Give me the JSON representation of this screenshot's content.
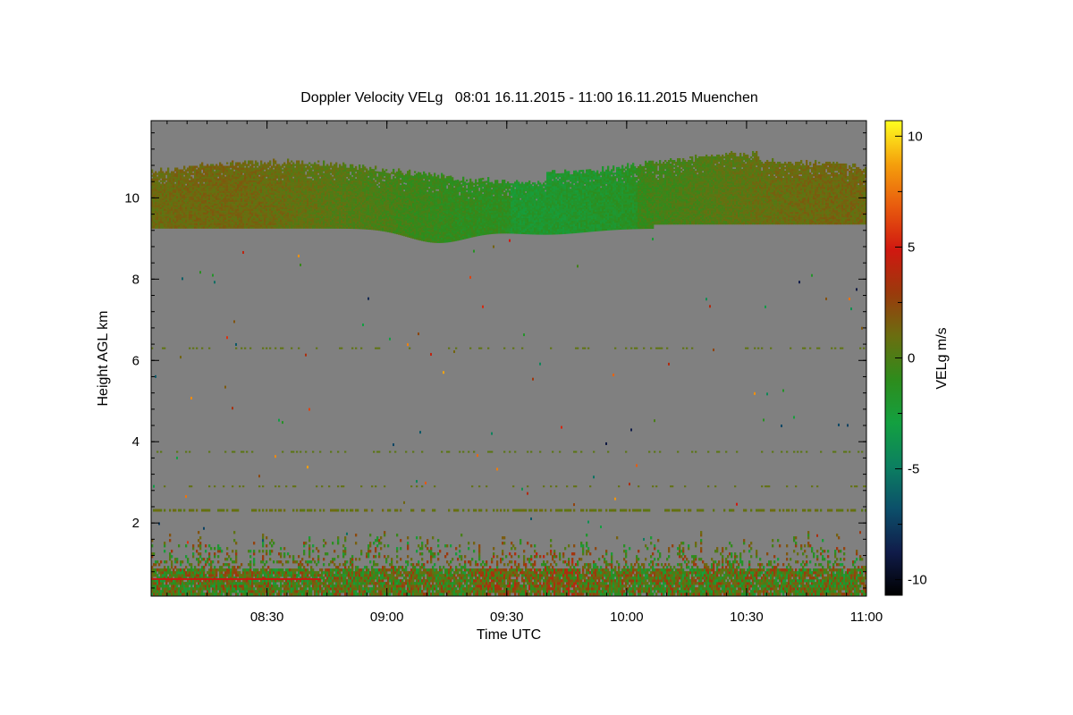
{
  "chart_data": {
    "type": "heatmap",
    "title": "Doppler Velocity VELg   08:01 16.11.2015 - 11:00 16.11.2015 Muenchen",
    "xlabel": "Time UTC",
    "ylabel": "Height AGL km",
    "colorbar_label": "VELg m/s",
    "x_range": [
      "08:01",
      "11:00"
    ],
    "x_tick_labels": [
      "08:30",
      "09:00",
      "09:30",
      "10:00",
      "10:30",
      "11:00"
    ],
    "x_tick_minutes": [
      29,
      59,
      89,
      119,
      149,
      179
    ],
    "x_total_minutes": 179,
    "ylim": [
      0.2,
      11.9
    ],
    "y_tick_labels": [
      "2",
      "4",
      "6",
      "8",
      "10"
    ],
    "y_tick_values": [
      2,
      4,
      6,
      8,
      10
    ],
    "clim": [
      -10.7,
      10.7
    ],
    "colorbar_tick_labels": [
      "10",
      "5",
      "0",
      "-5",
      "-10"
    ],
    "colorbar_tick_values": [
      10,
      5,
      0,
      -5,
      -10
    ],
    "colormap": [
      "#000000",
      "#101c4a",
      "#0c4f6a",
      "#0c8060",
      "#13a040",
      "#2e8c1c",
      "#6a6e10",
      "#9a3a0c",
      "#d01810",
      "#e85a0e",
      "#f5a00c",
      "#ffff20"
    ],
    "background_color": "#808080",
    "layers": [
      {
        "name": "cirrus",
        "top_km": [
          10.6,
          10.75
        ],
        "base_km": [
          9.2,
          8.75
        ],
        "velocity_ms": [
          -1.5,
          1.5
        ]
      },
      {
        "name": "boundary layer",
        "top_km": [
          1.65,
          0.2
        ],
        "velocity_ms": [
          -2,
          3
        ]
      },
      {
        "name": "level 2.3 km",
        "height_km": 2.3,
        "velocity_ms": [
          0,
          1
        ]
      }
    ]
  }
}
